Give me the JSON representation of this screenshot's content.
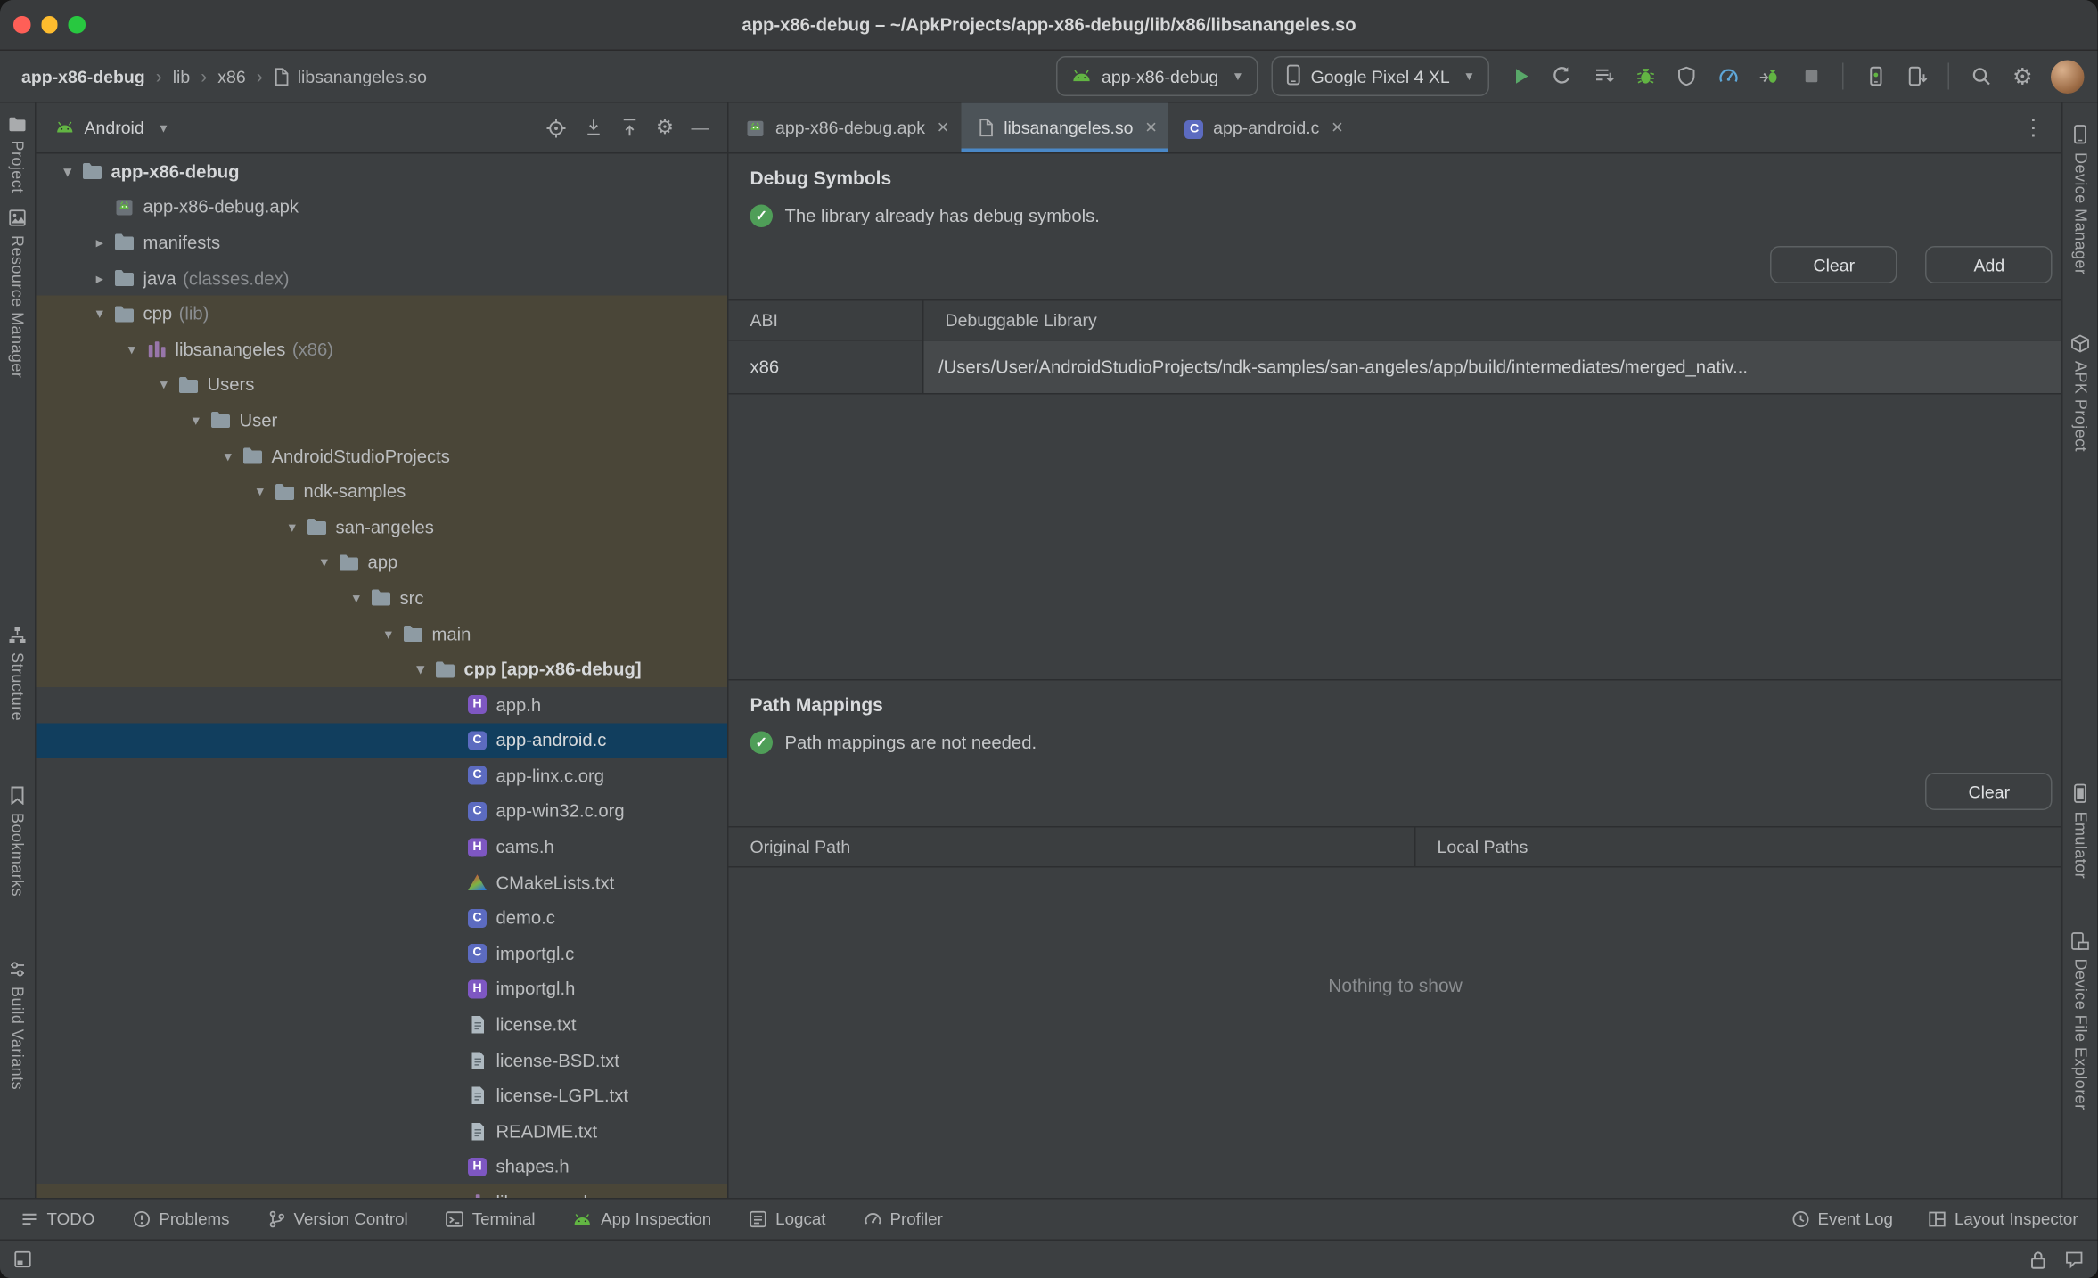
{
  "colors": {
    "panel_background": "#3c3f41",
    "accent_blue": "#4A88C7",
    "success_green": "#4F9E58",
    "android_green": "#62B543",
    "selection_blue": "#113E5E",
    "path_highlight": "#4A4638"
  },
  "glyphs": {
    "breadcrumb_separator": "›",
    "chevron_open": "▾",
    "chevron_closed": "▸",
    "close": "×",
    "more": "⋮",
    "gear": "⚙",
    "minus": "—"
  },
  "titlebar": {
    "title": "app-x86-debug – ~/ApkProjects/app-x86-debug/lib/x86/libsanangeles.so"
  },
  "toolbar": {
    "breadcrumbs": [
      "app-x86-debug",
      "lib",
      "x86",
      "libsanangeles.so"
    ],
    "run_config": {
      "label": "app-x86-debug"
    },
    "device": {
      "label": "Google Pixel 4 XL"
    },
    "icons": [
      "run",
      "apply-changes",
      "apply-code-changes",
      "debug",
      "profile-app",
      "profiler",
      "attach-debugger",
      "stop",
      "device-manager",
      "sdk-manager",
      "search",
      "settings",
      "avatar"
    ]
  },
  "left_stripe": {
    "items": [
      {
        "label": "Project",
        "icon": "project"
      },
      {
        "label": "Resource Manager",
        "icon": "resource-manager"
      },
      {
        "label": "Structure",
        "icon": "structure"
      },
      {
        "label": "Bookmarks",
        "icon": "bookmarks"
      },
      {
        "label": "Build Variants",
        "icon": "build-variants"
      }
    ]
  },
  "right_stripe": {
    "items": [
      {
        "label": "Device Manager",
        "icon": "phone"
      },
      {
        "label": "APK Project",
        "icon": "apk-project"
      },
      {
        "label": "Emulator",
        "icon": "emulator"
      },
      {
        "label": "Device File Explorer",
        "icon": "device-file-explorer"
      }
    ]
  },
  "project_panel": {
    "view": "Android",
    "tree": [
      {
        "label": "app-x86-debug",
        "level": 0,
        "chevron": "open",
        "icon": "folder",
        "bold": true
      },
      {
        "label": "app-x86-debug.apk",
        "level": 1,
        "chevron": "none",
        "icon": "apk"
      },
      {
        "label": "manifests",
        "level": 1,
        "chevron": "closed",
        "icon": "folder"
      },
      {
        "label": "java",
        "suffix": "(classes.dex)",
        "level": 1,
        "chevron": "closed",
        "icon": "folder"
      },
      {
        "label": "cpp",
        "suffix": "(lib)",
        "level": 1,
        "chevron": "open",
        "icon": "folder",
        "highlight": "path"
      },
      {
        "label": "libsanangeles",
        "suffix": "(x86)",
        "level": 2,
        "chevron": "open",
        "icon": "lib",
        "highlight": "path"
      },
      {
        "label": "Users",
        "level": 3,
        "chevron": "open",
        "icon": "folder",
        "highlight": "path"
      },
      {
        "label": "User",
        "level": 4,
        "chevron": "open",
        "icon": "folder",
        "highlight": "path"
      },
      {
        "label": "AndroidStudioProjects",
        "level": 5,
        "chevron": "open",
        "icon": "folder",
        "highlight": "path"
      },
      {
        "label": "ndk-samples",
        "level": 6,
        "chevron": "open",
        "icon": "folder",
        "highlight": "path"
      },
      {
        "label": "san-angeles",
        "level": 7,
        "chevron": "open",
        "icon": "folder",
        "highlight": "path"
      },
      {
        "label": "app",
        "level": 8,
        "chevron": "open",
        "icon": "folder",
        "highlight": "path"
      },
      {
        "label": "src",
        "level": 9,
        "chevron": "open",
        "icon": "folder",
        "highlight": "path"
      },
      {
        "label": "main",
        "level": 10,
        "chevron": "open",
        "icon": "folder",
        "highlight": "path"
      },
      {
        "label": "cpp [app-x86-debug]",
        "level": 11,
        "chevron": "open",
        "icon": "folder",
        "highlight": "path",
        "bold": true
      },
      {
        "label": "app.h",
        "level": 12,
        "chevron": "none",
        "icon": "h"
      },
      {
        "label": "app-android.c",
        "level": 12,
        "chevron": "none",
        "icon": "c",
        "highlight": "selected"
      },
      {
        "label": "app-linx.c.org",
        "level": 12,
        "chevron": "none",
        "icon": "c"
      },
      {
        "label": "app-win32.c.org",
        "level": 12,
        "chevron": "none",
        "icon": "c"
      },
      {
        "label": "cams.h",
        "level": 12,
        "chevron": "none",
        "icon": "h"
      },
      {
        "label": "CMakeLists.txt",
        "level": 12,
        "chevron": "none",
        "icon": "cmake"
      },
      {
        "label": "demo.c",
        "level": 12,
        "chevron": "none",
        "icon": "c"
      },
      {
        "label": "importgl.c",
        "level": 12,
        "chevron": "none",
        "icon": "c"
      },
      {
        "label": "importgl.h",
        "level": 12,
        "chevron": "none",
        "icon": "h"
      },
      {
        "label": "license.txt",
        "level": 12,
        "chevron": "none",
        "icon": "txt"
      },
      {
        "label": "license-BSD.txt",
        "level": 12,
        "chevron": "none",
        "icon": "txt"
      },
      {
        "label": "license-LGPL.txt",
        "level": 12,
        "chevron": "none",
        "icon": "txt"
      },
      {
        "label": "README.txt",
        "level": 12,
        "chevron": "none",
        "icon": "txt"
      },
      {
        "label": "shapes.h",
        "level": 12,
        "chevron": "none",
        "icon": "h"
      },
      {
        "label": "libsanangeles.so",
        "level": 12,
        "chevron": "none",
        "icon": "lib",
        "highlight": "path"
      }
    ]
  },
  "editor": {
    "tabs": [
      {
        "label": "app-x86-debug.apk",
        "icon": "apk",
        "active": false
      },
      {
        "label": "libsanangeles.so",
        "icon": "file",
        "active": true
      },
      {
        "label": "app-android.c",
        "icon": "c",
        "active": false
      }
    ],
    "debug_symbols": {
      "title": "Debug Symbols",
      "message": "The library already has debug symbols.",
      "buttons": {
        "clear": "Clear",
        "add": "Add"
      },
      "table": {
        "columns": [
          "ABI",
          "Debuggable Library"
        ],
        "rows": [
          {
            "abi": "x86",
            "library": "/Users/User/AndroidStudioProjects/ndk-samples/san-angeles/app/build/intermediates/merged_nativ..."
          }
        ]
      }
    },
    "path_mappings": {
      "title": "Path Mappings",
      "message": "Path mappings are not needed.",
      "buttons": {
        "clear": "Clear"
      },
      "table": {
        "columns": [
          "Original Path",
          "Local Paths"
        ]
      },
      "empty": "Nothing to show"
    }
  },
  "status_bar": {
    "left": [
      {
        "label": "TODO",
        "icon": "todo"
      },
      {
        "label": "Problems",
        "icon": "problems"
      },
      {
        "label": "Version Control",
        "icon": "vcs"
      },
      {
        "label": "Terminal",
        "icon": "terminal"
      },
      {
        "label": "App Inspection",
        "icon": "android"
      },
      {
        "label": "Logcat",
        "icon": "logcat"
      },
      {
        "label": "Profiler",
        "icon": "profiler"
      }
    ],
    "right": [
      {
        "label": "Event Log",
        "icon": "event-log"
      },
      {
        "label": "Layout Inspector",
        "icon": "layout-inspector"
      }
    ]
  }
}
